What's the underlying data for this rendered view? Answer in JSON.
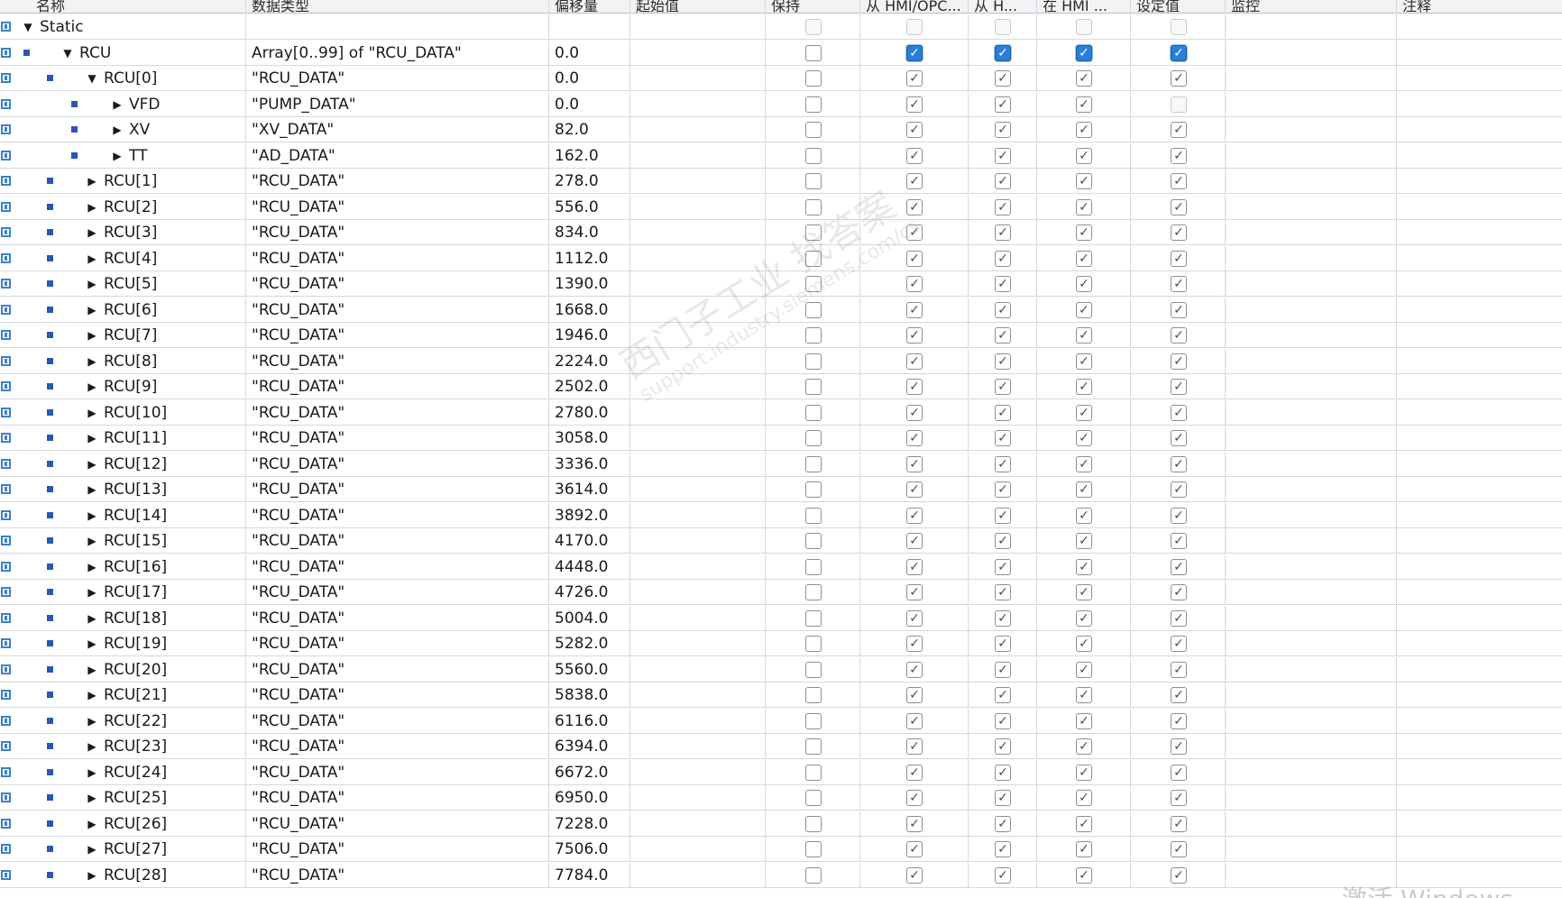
{
  "columns": {
    "name": "名称",
    "data_type": "数据类型",
    "offset": "偏移量",
    "start_value": "起始值",
    "retain": "保持",
    "hmi_opc_accessible": "从 HMI/OPC...",
    "hmi_visible": "从 H...",
    "hmi_writable": "在 HMI ...",
    "setpoint": "设定值",
    "monitor": "监控",
    "comment": "注释"
  },
  "rows": [
    {
      "level": 0,
      "expand": "open",
      "name": "Static",
      "type": "",
      "offset": "",
      "checks": [
        "disabled",
        "disabled",
        "disabled",
        "disabled",
        "disabled"
      ]
    },
    {
      "level": 1,
      "expand": "open",
      "name": "RCU",
      "type": "Array[0..99] of \"RCU_DATA\"",
      "offset": "0.0",
      "checks": [
        "off",
        "active",
        "active",
        "active",
        "active"
      ]
    },
    {
      "level": 2,
      "expand": "open",
      "name": "RCU[0]",
      "type": "\"RCU_DATA\"",
      "offset": "0.0",
      "checks": [
        "off",
        "on",
        "on",
        "on",
        "on"
      ]
    },
    {
      "level": 3,
      "expand": "closed",
      "name": "VFD",
      "type": "\"PUMP_DATA\"",
      "offset": "0.0",
      "checks": [
        "off",
        "on",
        "on",
        "on",
        "disabled"
      ]
    },
    {
      "level": 3,
      "expand": "closed",
      "name": "XV",
      "type": "\"XV_DATA\"",
      "offset": "82.0",
      "checks": [
        "off",
        "on",
        "on",
        "on",
        "on"
      ]
    },
    {
      "level": 3,
      "expand": "closed",
      "name": "TT",
      "type": "\"AD_DATA\"",
      "offset": "162.0",
      "checks": [
        "off",
        "on",
        "on",
        "on",
        "on"
      ]
    },
    {
      "level": 2,
      "expand": "closed",
      "name": "RCU[1]",
      "type": "\"RCU_DATA\"",
      "offset": "278.0",
      "checks": [
        "off",
        "on",
        "on",
        "on",
        "on"
      ]
    },
    {
      "level": 2,
      "expand": "closed",
      "name": "RCU[2]",
      "type": "\"RCU_DATA\"",
      "offset": "556.0",
      "checks": [
        "off",
        "on",
        "on",
        "on",
        "on"
      ]
    },
    {
      "level": 2,
      "expand": "closed",
      "name": "RCU[3]",
      "type": "\"RCU_DATA\"",
      "offset": "834.0",
      "checks": [
        "off",
        "on",
        "on",
        "on",
        "on"
      ]
    },
    {
      "level": 2,
      "expand": "closed",
      "name": "RCU[4]",
      "type": "\"RCU_DATA\"",
      "offset": "1112.0",
      "checks": [
        "off",
        "on",
        "on",
        "on",
        "on"
      ]
    },
    {
      "level": 2,
      "expand": "closed",
      "name": "RCU[5]",
      "type": "\"RCU_DATA\"",
      "offset": "1390.0",
      "checks": [
        "off",
        "on",
        "on",
        "on",
        "on"
      ]
    },
    {
      "level": 2,
      "expand": "closed",
      "name": "RCU[6]",
      "type": "\"RCU_DATA\"",
      "offset": "1668.0",
      "checks": [
        "off",
        "on",
        "on",
        "on",
        "on"
      ]
    },
    {
      "level": 2,
      "expand": "closed",
      "name": "RCU[7]",
      "type": "\"RCU_DATA\"",
      "offset": "1946.0",
      "checks": [
        "off",
        "on",
        "on",
        "on",
        "on"
      ]
    },
    {
      "level": 2,
      "expand": "closed",
      "name": "RCU[8]",
      "type": "\"RCU_DATA\"",
      "offset": "2224.0",
      "checks": [
        "off",
        "on",
        "on",
        "on",
        "on"
      ]
    },
    {
      "level": 2,
      "expand": "closed",
      "name": "RCU[9]",
      "type": "\"RCU_DATA\"",
      "offset": "2502.0",
      "checks": [
        "off",
        "on",
        "on",
        "on",
        "on"
      ]
    },
    {
      "level": 2,
      "expand": "closed",
      "name": "RCU[10]",
      "type": "\"RCU_DATA\"",
      "offset": "2780.0",
      "checks": [
        "off",
        "on",
        "on",
        "on",
        "on"
      ]
    },
    {
      "level": 2,
      "expand": "closed",
      "name": "RCU[11]",
      "type": "\"RCU_DATA\"",
      "offset": "3058.0",
      "checks": [
        "off",
        "on",
        "on",
        "on",
        "on"
      ]
    },
    {
      "level": 2,
      "expand": "closed",
      "name": "RCU[12]",
      "type": "\"RCU_DATA\"",
      "offset": "3336.0",
      "checks": [
        "off",
        "on",
        "on",
        "on",
        "on"
      ]
    },
    {
      "level": 2,
      "expand": "closed",
      "name": "RCU[13]",
      "type": "\"RCU_DATA\"",
      "offset": "3614.0",
      "checks": [
        "off",
        "on",
        "on",
        "on",
        "on"
      ]
    },
    {
      "level": 2,
      "expand": "closed",
      "name": "RCU[14]",
      "type": "\"RCU_DATA\"",
      "offset": "3892.0",
      "checks": [
        "off",
        "on",
        "on",
        "on",
        "on"
      ]
    },
    {
      "level": 2,
      "expand": "closed",
      "name": "RCU[15]",
      "type": "\"RCU_DATA\"",
      "offset": "4170.0",
      "checks": [
        "off",
        "on",
        "on",
        "on",
        "on"
      ]
    },
    {
      "level": 2,
      "expand": "closed",
      "name": "RCU[16]",
      "type": "\"RCU_DATA\"",
      "offset": "4448.0",
      "checks": [
        "off",
        "on",
        "on",
        "on",
        "on"
      ]
    },
    {
      "level": 2,
      "expand": "closed",
      "name": "RCU[17]",
      "type": "\"RCU_DATA\"",
      "offset": "4726.0",
      "checks": [
        "off",
        "on",
        "on",
        "on",
        "on"
      ]
    },
    {
      "level": 2,
      "expand": "closed",
      "name": "RCU[18]",
      "type": "\"RCU_DATA\"",
      "offset": "5004.0",
      "checks": [
        "off",
        "on",
        "on",
        "on",
        "on"
      ]
    },
    {
      "level": 2,
      "expand": "closed",
      "name": "RCU[19]",
      "type": "\"RCU_DATA\"",
      "offset": "5282.0",
      "checks": [
        "off",
        "on",
        "on",
        "on",
        "on"
      ]
    },
    {
      "level": 2,
      "expand": "closed",
      "name": "RCU[20]",
      "type": "\"RCU_DATA\"",
      "offset": "5560.0",
      "checks": [
        "off",
        "on",
        "on",
        "on",
        "on"
      ]
    },
    {
      "level": 2,
      "expand": "closed",
      "name": "RCU[21]",
      "type": "\"RCU_DATA\"",
      "offset": "5838.0",
      "checks": [
        "off",
        "on",
        "on",
        "on",
        "on"
      ]
    },
    {
      "level": 2,
      "expand": "closed",
      "name": "RCU[22]",
      "type": "\"RCU_DATA\"",
      "offset": "6116.0",
      "checks": [
        "off",
        "on",
        "on",
        "on",
        "on"
      ]
    },
    {
      "level": 2,
      "expand": "closed",
      "name": "RCU[23]",
      "type": "\"RCU_DATA\"",
      "offset": "6394.0",
      "checks": [
        "off",
        "on",
        "on",
        "on",
        "on"
      ]
    },
    {
      "level": 2,
      "expand": "closed",
      "name": "RCU[24]",
      "type": "\"RCU_DATA\"",
      "offset": "6672.0",
      "checks": [
        "off",
        "on",
        "on",
        "on",
        "on"
      ]
    },
    {
      "level": 2,
      "expand": "closed",
      "name": "RCU[25]",
      "type": "\"RCU_DATA\"",
      "offset": "6950.0",
      "checks": [
        "off",
        "on",
        "on",
        "on",
        "on"
      ]
    },
    {
      "level": 2,
      "expand": "closed",
      "name": "RCU[26]",
      "type": "\"RCU_DATA\"",
      "offset": "7228.0",
      "checks": [
        "off",
        "on",
        "on",
        "on",
        "on"
      ]
    },
    {
      "level": 2,
      "expand": "closed",
      "name": "RCU[27]",
      "type": "\"RCU_DATA\"",
      "offset": "7506.0",
      "checks": [
        "off",
        "on",
        "on",
        "on",
        "on"
      ]
    },
    {
      "level": 2,
      "expand": "closed",
      "name": "RCU[28]",
      "type": "\"RCU_DATA\"",
      "offset": "7784.0",
      "checks": [
        "off",
        "on",
        "on",
        "on",
        "on"
      ]
    }
  ],
  "watermark": {
    "line1": "西门子工业 找答案",
    "line2": "support.industry.siemens.com/cs"
  },
  "os_notice": "激活 Windows",
  "colors": {
    "active_checkbox": "#2a7ed8",
    "bullet": "#2b55b8",
    "db_icon": "#3b82c8",
    "grid_line": "#d4d8dc"
  }
}
